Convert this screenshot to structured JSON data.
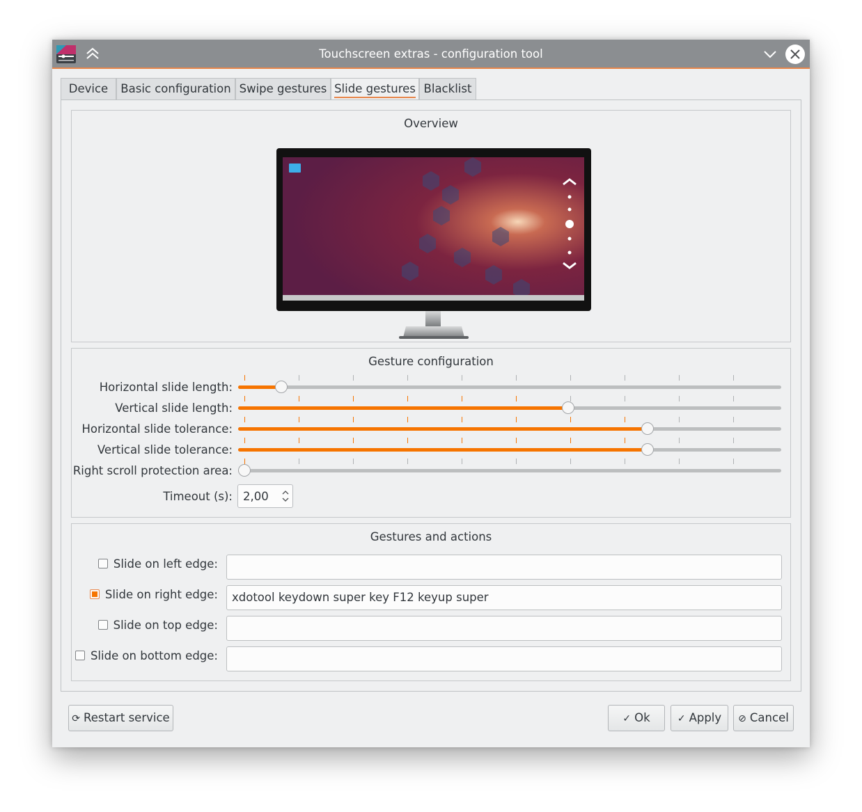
{
  "window": {
    "title": "Touchscreen extras - configuration tool"
  },
  "icons": {
    "app": "app-icon",
    "keep_above": "keep-above-icon",
    "minimize": "chevron-down-icon",
    "close": "close-icon"
  },
  "tabs": [
    {
      "label": "Device",
      "active": false
    },
    {
      "label": "Basic configuration",
      "active": false
    },
    {
      "label": "Swipe gestures",
      "active": false
    },
    {
      "label": "Slide gestures",
      "active": true
    },
    {
      "label": "Blacklist",
      "active": false
    }
  ],
  "overview": {
    "title": "Overview"
  },
  "gesture_config": {
    "title": "Gesture configuration",
    "sliders": [
      {
        "label": "Horizontal slide length:",
        "fraction": 0.07
      },
      {
        "label": "Vertical slide length:",
        "fraction": 0.61
      },
      {
        "label": "Horizontal slide tolerance:",
        "fraction": 0.76
      },
      {
        "label": "Vertical slide tolerance:",
        "fraction": 0.76
      },
      {
        "label": "Right scroll protection area:",
        "fraction": 0.0
      }
    ],
    "timeout": {
      "label": "Timeout (s):",
      "value": "2,00"
    }
  },
  "gestures_actions": {
    "title": "Gestures and actions",
    "rows": [
      {
        "label": "Slide on left edge:",
        "checked": false,
        "value": ""
      },
      {
        "label": "Slide on right edge:",
        "checked": true,
        "value": "xdotool keydown super key F12 keyup super"
      },
      {
        "label": "Slide on top edge:",
        "checked": false,
        "value": ""
      },
      {
        "label": "Slide on bottom edge:",
        "checked": false,
        "value": ""
      }
    ]
  },
  "buttons": {
    "restart": "Restart service",
    "ok": "Ok",
    "apply": "Apply",
    "cancel": "Cancel"
  },
  "colors": {
    "accent": "#f67400",
    "titlebar": "#8b8e91",
    "window_bg": "#eff0f1"
  }
}
